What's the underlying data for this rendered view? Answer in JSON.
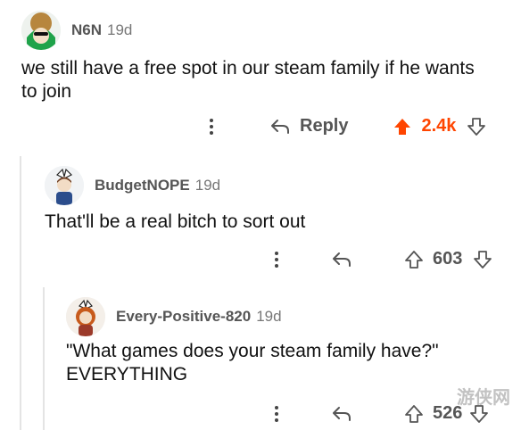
{
  "colors": {
    "accent_upvote": "#ff4500",
    "text_meta": "#555555"
  },
  "comments": [
    {
      "username": "N6N",
      "age": "19d",
      "text": "we still have a free spot in our steam family if he wants to join",
      "reply_label": "Reply",
      "score": "2.4k",
      "upvoted": true
    },
    {
      "username": "BudgetNOPE",
      "age": "19d",
      "text": "That'll be a real bitch to sort out",
      "score": "603"
    },
    {
      "username": "Every-Positive-820",
      "age": "19d",
      "text_line1": "\"What games does your steam family have?\"",
      "text_line2": "EVERYTHING",
      "score": "526"
    }
  ],
  "watermark": "游侠网"
}
